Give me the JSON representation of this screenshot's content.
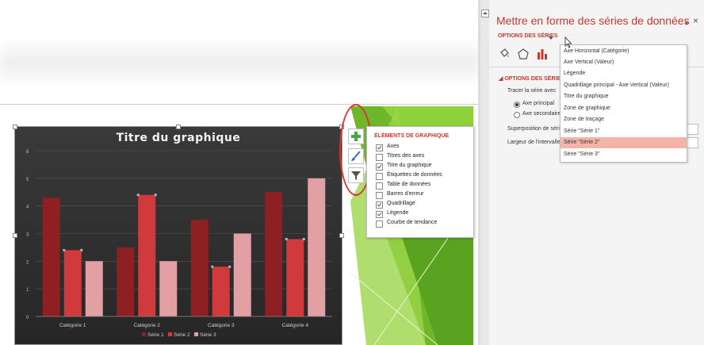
{
  "chart": {
    "title": "Titre du graphique"
  },
  "chart_data": {
    "type": "bar",
    "title": "Titre du graphique",
    "categories": [
      "Catégorie 1",
      "Catégorie 2",
      "Catégorie 3",
      "Catégorie 4"
    ],
    "series": [
      {
        "name": "Série 1",
        "values": [
          4.3,
          2.5,
          3.5,
          4.5
        ],
        "color": "#8e1f22"
      },
      {
        "name": "Série 2",
        "values": [
          2.4,
          4.4,
          1.8,
          2.8
        ],
        "color": "#d03a3c"
      },
      {
        "name": "Série 3",
        "values": [
          2.0,
          2.0,
          3.0,
          5.0
        ],
        "color": "#e2a0a5"
      }
    ],
    "ylim": [
      0,
      6
    ],
    "yticks": [
      "0",
      "1",
      "2",
      "3",
      "4",
      "5",
      "6"
    ],
    "grid": true,
    "legend": "bottom"
  },
  "chart_tools": {
    "buttons": [
      {
        "name": "chart-elements-button",
        "icon": "plus-icon"
      },
      {
        "name": "chart-styles-button",
        "icon": "brush-icon"
      },
      {
        "name": "chart-filters-button",
        "icon": "filter-icon"
      }
    ]
  },
  "elements_popup": {
    "title": "ÉLÉMENTS DE GRAPHIQUE",
    "items": [
      {
        "label": "Axes",
        "checked": true
      },
      {
        "label": "Titres des axes",
        "checked": false
      },
      {
        "label": "Titre du graphique",
        "checked": true
      },
      {
        "label": "Étiquettes de données",
        "checked": false
      },
      {
        "label": "Table de données",
        "checked": false
      },
      {
        "label": "Barres d'erreur",
        "checked": false
      },
      {
        "label": "Quadrillage",
        "checked": true
      },
      {
        "label": "Légende",
        "checked": true
      },
      {
        "label": "Courbe de tendance",
        "checked": false
      }
    ]
  },
  "pane": {
    "title": "Mettre en forme des séries de données",
    "close_glyph": "×",
    "options_label": "OPTIONS DES SÉRIES",
    "section_label": "OPTIONS DES SÉRIES",
    "plot_on_label": "Tracer la série avec",
    "axis_primary": "Axe principal",
    "axis_secondary": "Axe secondaire",
    "overlap_label": "Superposition de séries",
    "gap_width_label": "Largeur de l'intervalle"
  },
  "dropdown": {
    "items": [
      "Axe Horizontal (Catégorie)",
      "Axe Vertical (Valeur)",
      "Légende",
      "Quadrillage principal - Axe Vertical (Valeur)",
      "Titre du graphique",
      "Zone de graphique",
      "Zone de traçage",
      "Série \"Série 1\"",
      "Série \"Série 2\"",
      "Série \"Série 3\""
    ],
    "selected_index": 8
  },
  "colors": {
    "accent": "#c8372d",
    "selection": "#f4b4a8",
    "green": "#7bbf2e"
  }
}
